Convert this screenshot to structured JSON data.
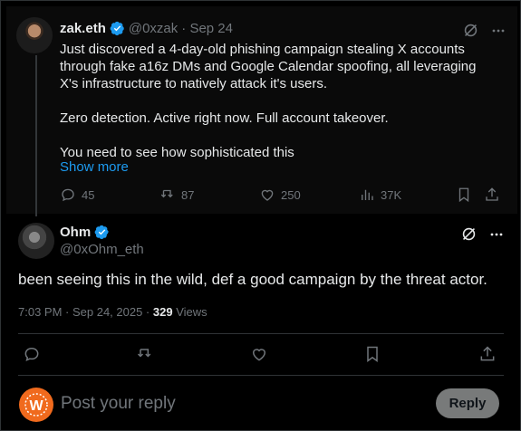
{
  "parent_tweet": {
    "display_name": "zak.eth",
    "handle": "@0xzak",
    "date": "· Sep 24",
    "paragraphs": [
      "Just discovered a 4-day-old phishing campaign stealing X accounts through fake a16z DMs and Google Calendar spoofing, all leveraging X's infrastructure to natively attack it's users.",
      "Zero detection. Active right now. Full account takeover.",
      "You need to see how sophisticated this"
    ],
    "show_more": "Show more",
    "replies": "45",
    "reposts": "87",
    "likes": "250",
    "views": "37K"
  },
  "reply_tweet": {
    "display_name": "Ohm",
    "handle": "@0xOhm_eth",
    "text": "been seeing this in the wild, def a good campaign by the threat actor.",
    "time": "7:03 PM · Sep 24, 2025 · ",
    "views_count": "329",
    "views_label": " Views"
  },
  "composer": {
    "placeholder": "Post your reply",
    "reply_button": "Reply"
  },
  "colors": {
    "accent": "#1d9bf0",
    "muted": "#71767b",
    "text": "#e7e9ea",
    "background": "#000000"
  }
}
